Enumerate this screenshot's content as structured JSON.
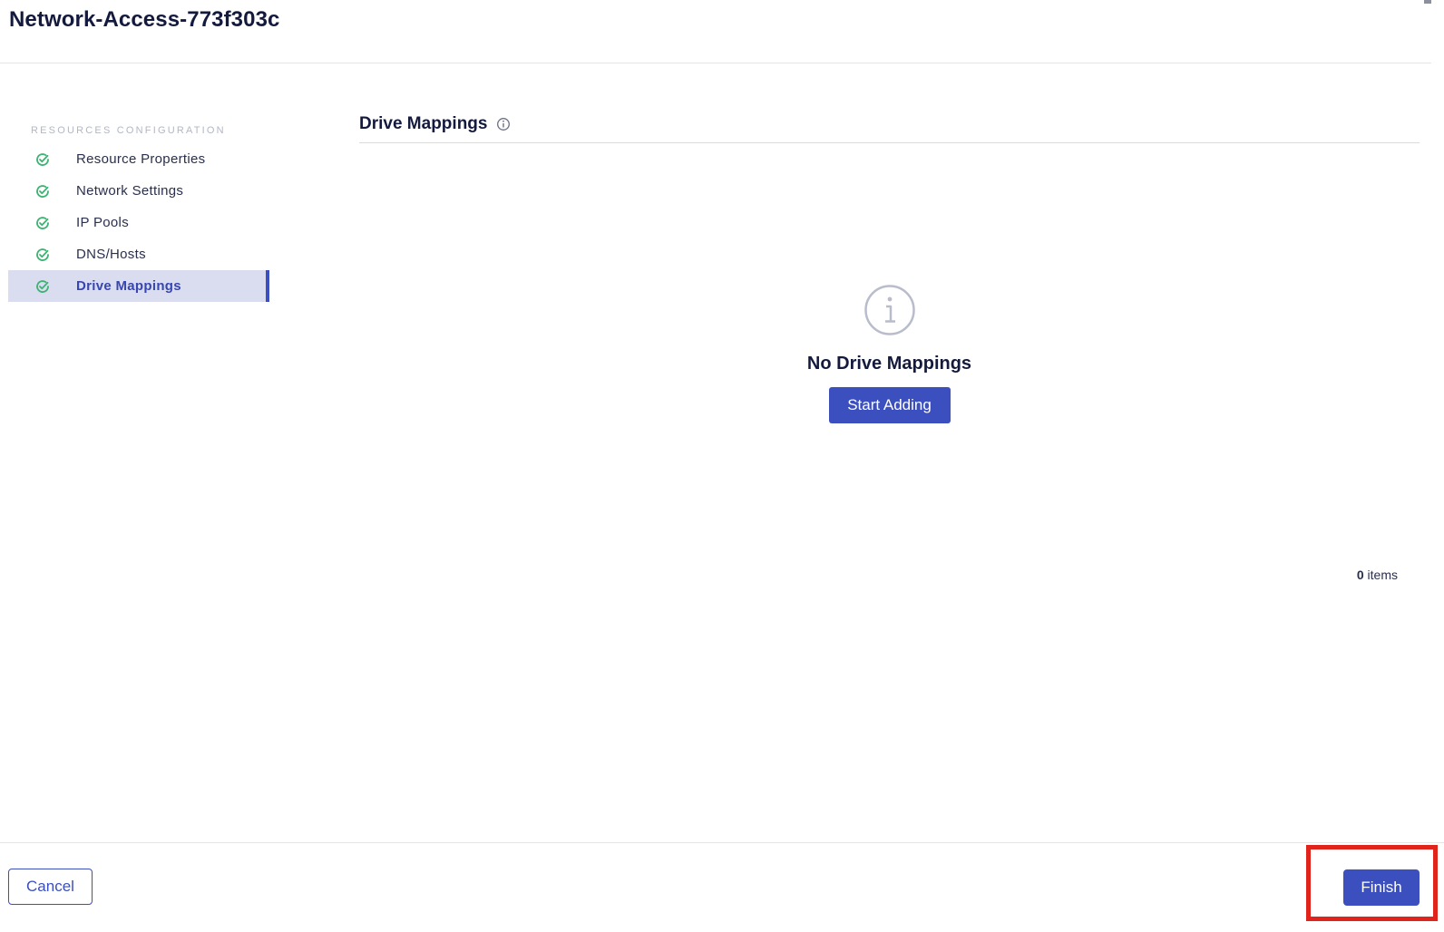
{
  "header": {
    "title": "Network-Access-773f303c"
  },
  "sidebar": {
    "section_title": "RESOURCES CONFIGURATION",
    "items": [
      {
        "label": "Resource Properties",
        "status": "complete",
        "active": false
      },
      {
        "label": "Network Settings",
        "status": "complete",
        "active": false
      },
      {
        "label": "IP Pools",
        "status": "complete",
        "active": false
      },
      {
        "label": "DNS/Hosts",
        "status": "complete",
        "active": false
      },
      {
        "label": "Drive Mappings",
        "status": "complete",
        "active": true
      }
    ]
  },
  "main": {
    "section_title": "Drive Mappings",
    "empty_state": {
      "icon": "info-circle-icon",
      "title": "No Drive Mappings",
      "button_label": "Start Adding"
    },
    "items_count": {
      "count": "0",
      "label": "items"
    }
  },
  "footer": {
    "cancel_label": "Cancel",
    "finish_label": "Finish"
  },
  "colors": {
    "accent": "#3b4fbf",
    "check": "#3cb371",
    "highlight": "#e0231b",
    "active_bg": "#dadcf0"
  }
}
